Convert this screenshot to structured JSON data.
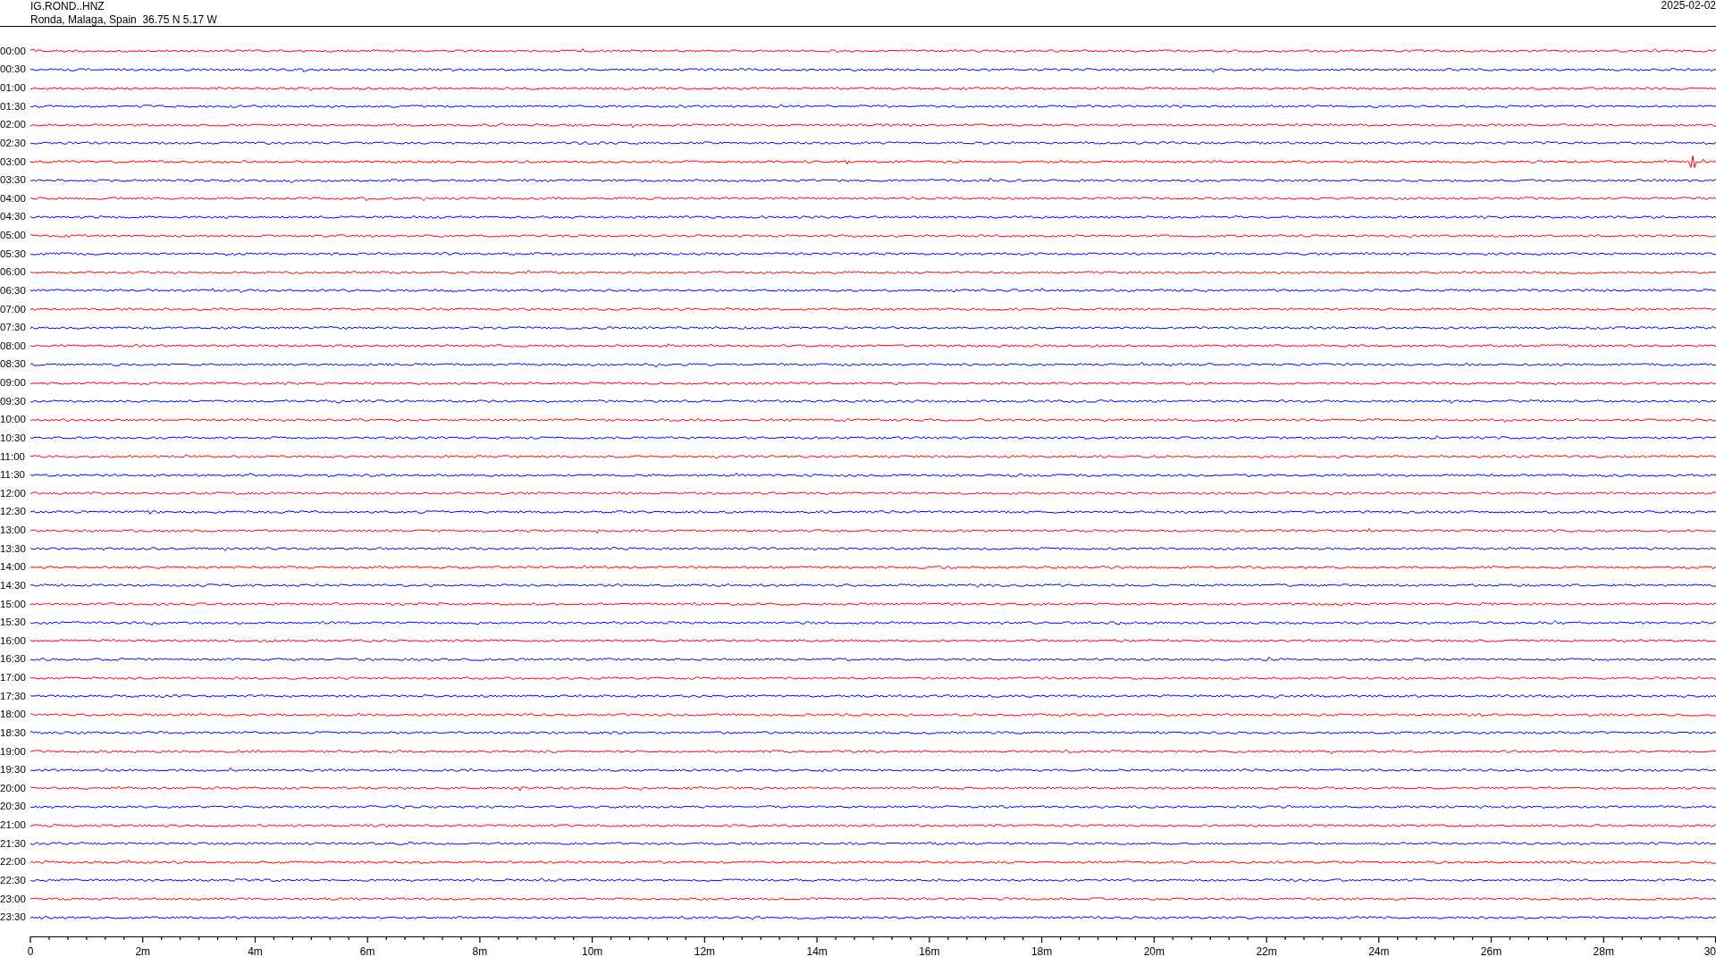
{
  "header": {
    "station": "IG.ROND..HNZ",
    "location": "Ronda, Malaga, Spain  36.75 N 5.17 W",
    "date": "2025-02-02"
  },
  "traces": [
    {
      "time": "00:00",
      "color": "#ff0000"
    },
    {
      "time": "00:30",
      "color": "#0000ff"
    },
    {
      "time": "01:00",
      "color": "#ff0000"
    },
    {
      "time": "01:30",
      "color": "#0000ff"
    },
    {
      "time": "02:00",
      "color": "#ff0000"
    },
    {
      "time": "02:30",
      "color": "#0000ff"
    },
    {
      "time": "03:00",
      "color": "#ff0000"
    },
    {
      "time": "03:30",
      "color": "#0000ff"
    },
    {
      "time": "04:00",
      "color": "#ff0000"
    },
    {
      "time": "04:30",
      "color": "#0000ff"
    },
    {
      "time": "05:00",
      "color": "#ff0000"
    },
    {
      "time": "05:30",
      "color": "#0000ff"
    },
    {
      "time": "06:00",
      "color": "#ff0000"
    },
    {
      "time": "06:30",
      "color": "#0000ff"
    },
    {
      "time": "07:00",
      "color": "#ff0000"
    },
    {
      "time": "07:30",
      "color": "#0000ff"
    },
    {
      "time": "08:00",
      "color": "#ff0000"
    },
    {
      "time": "08:30",
      "color": "#0000ff"
    },
    {
      "time": "09:00",
      "color": "#ff0000"
    },
    {
      "time": "09:30",
      "color": "#0000ff"
    },
    {
      "time": "10:00",
      "color": "#ff0000"
    },
    {
      "time": "10:30",
      "color": "#0000ff"
    },
    {
      "time": "11:00",
      "color": "#ff0000"
    },
    {
      "time": "11:30",
      "color": "#0000ff"
    },
    {
      "time": "12:00",
      "color": "#ff0000"
    },
    {
      "time": "12:30",
      "color": "#0000ff"
    },
    {
      "time": "13:00",
      "color": "#ff0000"
    },
    {
      "time": "13:30",
      "color": "#0000ff"
    },
    {
      "time": "14:00",
      "color": "#ff0000"
    },
    {
      "time": "14:30",
      "color": "#0000ff"
    },
    {
      "time": "15:00",
      "color": "#ff0000"
    },
    {
      "time": "15:30",
      "color": "#0000ff"
    },
    {
      "time": "16:00",
      "color": "#ff0000"
    },
    {
      "time": "16:30",
      "color": "#0000ff"
    },
    {
      "time": "17:00",
      "color": "#ff0000"
    },
    {
      "time": "17:30",
      "color": "#0000ff"
    },
    {
      "time": "18:00",
      "color": "#ff0000"
    },
    {
      "time": "18:30",
      "color": "#0000ff"
    },
    {
      "time": "19:00",
      "color": "#ff0000"
    },
    {
      "time": "19:30",
      "color": "#0000ff"
    },
    {
      "time": "20:00",
      "color": "#ff0000"
    },
    {
      "time": "20:30",
      "color": "#0000ff"
    },
    {
      "time": "21:00",
      "color": "#ff0000"
    },
    {
      "time": "21:30",
      "color": "#0000ff"
    },
    {
      "time": "22:00",
      "color": "#ff0000"
    },
    {
      "time": "22:30",
      "color": "#0000ff"
    },
    {
      "time": "23:00",
      "color": "#ff0000"
    },
    {
      "time": "23:30",
      "color": "#0000ff"
    }
  ],
  "axis": {
    "labels": [
      "0",
      "2m",
      "4m",
      "6m",
      "8m",
      "10m",
      "12m",
      "14m",
      "16m",
      "18m",
      "20m",
      "22m",
      "24m",
      "26m",
      "28m",
      "30"
    ]
  }
}
